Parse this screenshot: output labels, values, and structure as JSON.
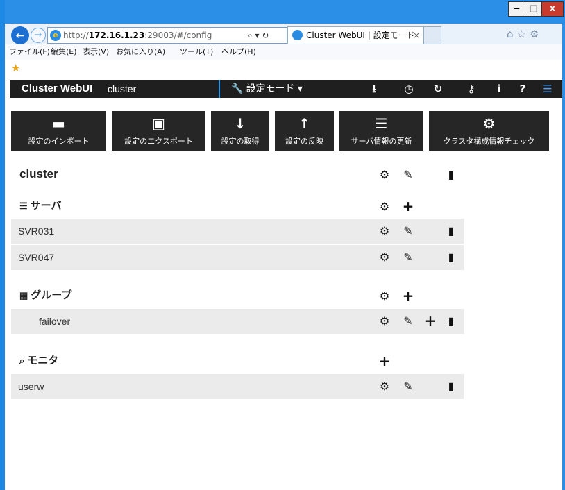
{
  "window": {
    "min_glyph": "‒",
    "max_glyph": "□",
    "close_glyph": "x"
  },
  "browser": {
    "back_glyph": "←",
    "forward_glyph": "→",
    "url_prefix": "http://",
    "url_host": "172.16.1.23",
    "url_rest": ":29003/#/config",
    "addr_tools": "⌕ ▾ ↻",
    "tab_title": "Cluster WebUI | 設定モード",
    "tab_close": "×",
    "toolbar_icons": "⌂☆⚙",
    "fav_icon": "★"
  },
  "menubar": {
    "items": [
      "ファイル(F)",
      "編集(E)",
      "表示(V)",
      "お気に入り(A)",
      "ツール(T)",
      "ヘルプ(H)"
    ]
  },
  "header": {
    "app_title": "Cluster WebUI",
    "cluster_name": "cluster",
    "mode_wrench": "🔧",
    "mode_label": "設定モード ▾",
    "icons": {
      "download": "⭳",
      "history": "◷",
      "refresh": "↻",
      "key": "⚷",
      "info": "i",
      "help": "?",
      "list": "☰"
    }
  },
  "toolbar": {
    "buttons": [
      {
        "label": "設定のインポート",
        "icon": "▬"
      },
      {
        "label": "設定のエクスポート",
        "icon": "▣"
      },
      {
        "label": "設定の取得",
        "icon": "↓"
      },
      {
        "label": "設定の反映",
        "icon": "↑"
      },
      {
        "label": "サーバ情報の更新",
        "icon": "☰"
      },
      {
        "label": "クラスタ構成情報チェック",
        "icon": "⚙"
      }
    ]
  },
  "content": {
    "cluster_title": "cluster",
    "actions": {
      "properties": "⚙",
      "edit": "✎",
      "add": "+",
      "delete": "▮"
    },
    "servers": {
      "icon": "☰",
      "title": "サーバ",
      "items": [
        "SVR031",
        "SVR047"
      ]
    },
    "groups": {
      "icon": "▦",
      "title": "グループ",
      "items": [
        "failover"
      ]
    },
    "monitors": {
      "icon": "⌕",
      "title": "モニタ",
      "items": [
        "userw"
      ]
    }
  }
}
